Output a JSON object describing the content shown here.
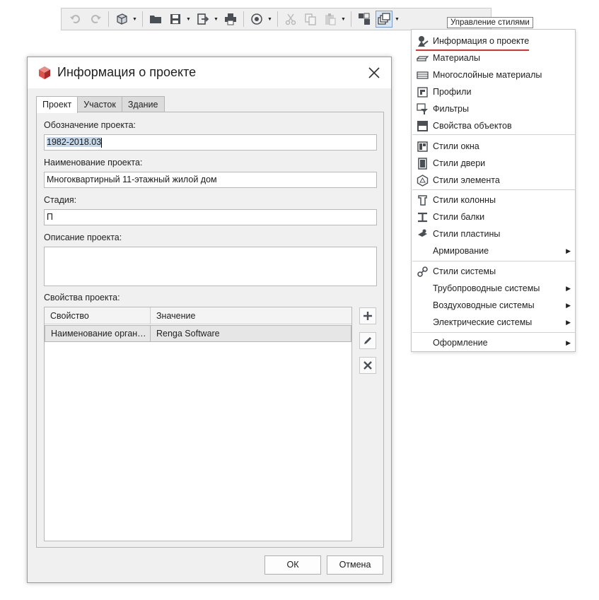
{
  "toolbar": {
    "tooltip": "Управление стилями",
    "icons": [
      "undo-icon",
      "redo-icon",
      "3d-view-icon",
      "open-folder-icon",
      "save-icon",
      "export-icon",
      "print-icon",
      "cloud-icon",
      "cut-icon",
      "copy-icon",
      "paste-icon",
      "layers-icon",
      "styles-manager-icon"
    ]
  },
  "menu": {
    "items": [
      {
        "label": "Информация о проекте",
        "icon": "project-info-icon"
      },
      {
        "label": "Материалы",
        "icon": "materials-icon"
      },
      {
        "label": "Многослойные материалы",
        "icon": "layered-materials-icon"
      },
      {
        "label": "Профили",
        "icon": "profiles-icon"
      },
      {
        "label": "Фильтры",
        "icon": "filters-icon"
      },
      {
        "label": "Свойства объектов",
        "icon": "object-properties-icon"
      },
      {
        "label": "Стили окна",
        "icon": "window-styles-icon"
      },
      {
        "label": "Стили двери",
        "icon": "door-styles-icon"
      },
      {
        "label": "Стили элемента",
        "icon": "element-styles-icon"
      },
      {
        "label": "Стили колонны",
        "icon": "column-styles-icon"
      },
      {
        "label": "Стили балки",
        "icon": "beam-styles-icon"
      },
      {
        "label": "Стили пластины",
        "icon": "plate-styles-icon"
      },
      {
        "label": "Армирование",
        "icon": ""
      },
      {
        "label": "Стили системы",
        "icon": "system-styles-icon"
      },
      {
        "label": "Трубопроводные системы",
        "icon": ""
      },
      {
        "label": "Воздуховодные системы",
        "icon": ""
      },
      {
        "label": "Электрические системы",
        "icon": ""
      },
      {
        "label": "Оформление",
        "icon": ""
      }
    ],
    "accent_underline": "#e03131"
  },
  "dialog": {
    "title": "Информация о проекте",
    "tabs": [
      "Проект",
      "Участок",
      "Здание"
    ],
    "fields": {
      "designation_label": "Обозначение проекта:",
      "designation_value": "1982-2018.03",
      "name_label": "Наименование проекта:",
      "name_value": "Многоквартирный 11-этажный жилой дом",
      "stage_label": "Стадия:",
      "stage_value": "П",
      "description_label": "Описание проекта:",
      "description_value": ""
    },
    "properties": {
      "label": "Свойства проекта:",
      "columns": [
        "Свойство",
        "Значение"
      ],
      "rows": [
        {
          "property": "Наименование организации",
          "value": "Renga Software"
        }
      ]
    },
    "buttons": {
      "ok": "ОК",
      "cancel": "Отмена"
    }
  }
}
